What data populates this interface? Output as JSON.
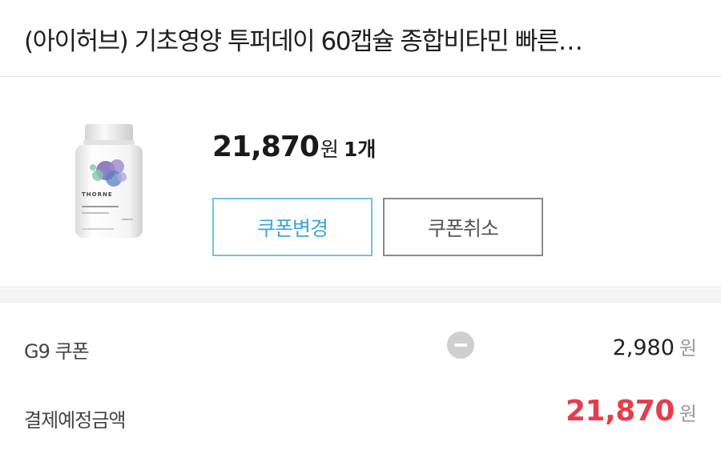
{
  "header": {
    "title": "(아이허브) 기초영양 투퍼데이 60캡슐 종합비타민 빠른…"
  },
  "product": {
    "image_icon": "thorne-bottle-image",
    "image_label": "THORNE",
    "price": "21,870",
    "price_unit": "원",
    "quantity": "1개",
    "coupon_change_label": "쿠폰변경",
    "coupon_cancel_label": "쿠폰취소"
  },
  "summary": {
    "coupon_label": "G9 쿠폰",
    "coupon_icon": "minus-icon",
    "coupon_amount": "2,980",
    "coupon_unit": "원",
    "total_label": "결제예정금액",
    "total_amount": "21,870",
    "total_unit": "원"
  },
  "colors": {
    "accent_blue": "#6fc3e8",
    "total_red": "#e53d4b",
    "border_gray": "#8a8a8a"
  }
}
